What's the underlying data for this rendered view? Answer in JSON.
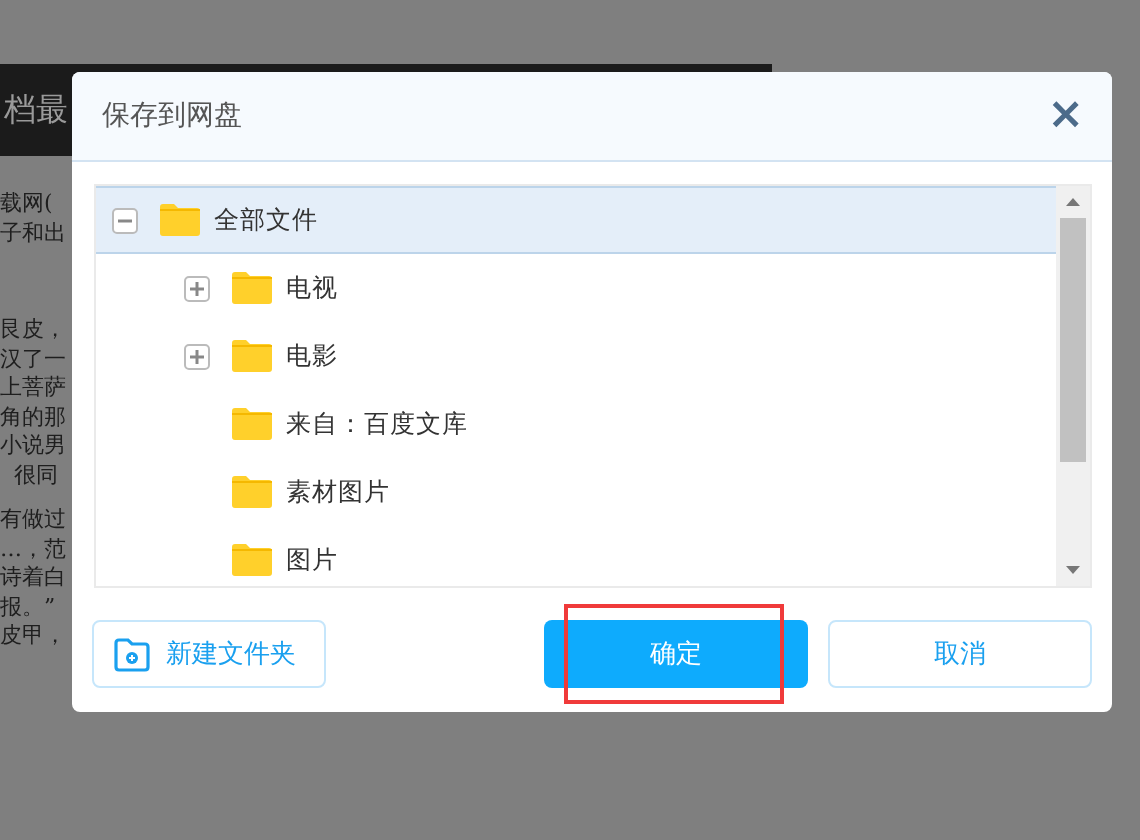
{
  "background": {
    "banner_text": "档最",
    "text_groups": [
      [
        "载网(",
        "子和出"
      ],
      [
        "艮皮，",
        "汉了一",
        "上菩萨",
        "角的那",
        "小说男",
        "  很同"
      ],
      [
        "有做过",
        "…，范",
        "诗着白",
        "报。”",
        "皮甲，"
      ]
    ]
  },
  "dialog": {
    "title": "保存到网盘",
    "close": "×",
    "tree": [
      {
        "label": "全部文件",
        "expanded": true,
        "selected": true,
        "children": [
          {
            "label": "电视",
            "expanded": false,
            "selected": false
          },
          {
            "label": "电影",
            "expanded": false,
            "selected": false
          },
          {
            "label": "来自：百度文库",
            "selected": false
          },
          {
            "label": "素材图片",
            "selected": false
          },
          {
            "label": "图片",
            "selected": false
          }
        ]
      }
    ],
    "new_folder_button": "新建文件夹",
    "confirm_button": "确定",
    "cancel_button": "取消",
    "confirm_highlighted": true
  }
}
